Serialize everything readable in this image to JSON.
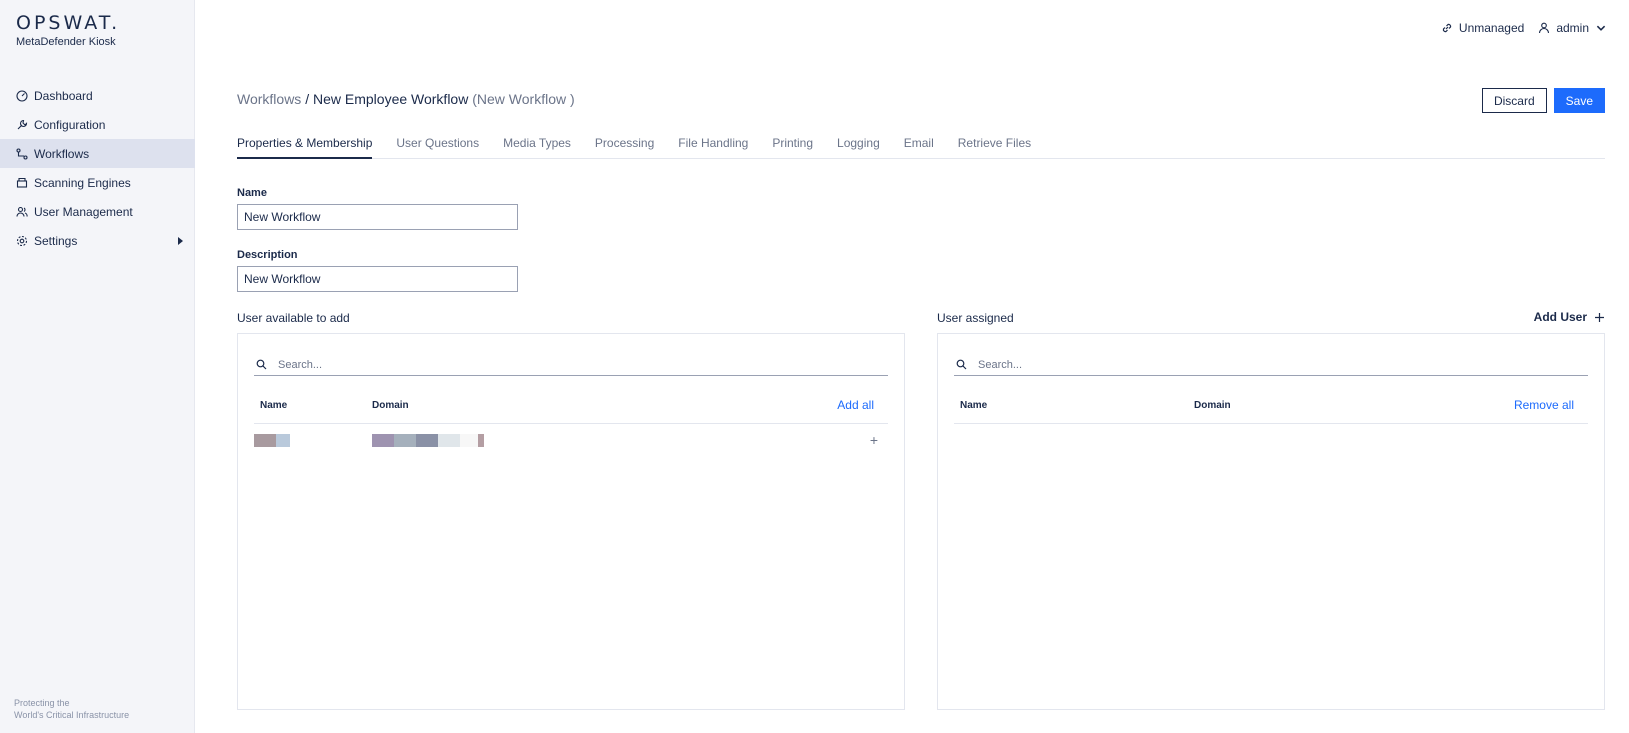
{
  "brand": {
    "logo": "OPSWAT.",
    "product": "MetaDefender Kiosk"
  },
  "nav": [
    {
      "label": "Dashboard",
      "icon": "gauge-icon"
    },
    {
      "label": "Configuration",
      "icon": "wrench-icon"
    },
    {
      "label": "Workflows",
      "icon": "workflow-icon",
      "active": true
    },
    {
      "label": "Scanning Engines",
      "icon": "engine-icon"
    },
    {
      "label": "User Management",
      "icon": "users-icon"
    },
    {
      "label": "Settings",
      "icon": "gear-icon"
    }
  ],
  "sidebar_footer": {
    "line1": "Protecting the",
    "line2": "World's Critical Infrastructure"
  },
  "topbar": {
    "status": "Unmanaged",
    "user": "admin"
  },
  "breadcrumb": {
    "root": "Workflows",
    "separator": "/",
    "current": "New Employee Workflow",
    "suffix": "(New Workflow )"
  },
  "actions": {
    "discard": "Discard",
    "save": "Save"
  },
  "tabs": [
    "Properties & Membership",
    "User Questions",
    "Media Types",
    "Processing",
    "File Handling",
    "Printing",
    "Logging",
    "Email",
    "Retrieve Files"
  ],
  "form": {
    "name_label": "Name",
    "name_value": "New Workflow",
    "description_label": "Description",
    "description_value": "New Workflow"
  },
  "available": {
    "title": "User available to add",
    "search_placeholder": "Search...",
    "col_name": "Name",
    "col_domain": "Domain",
    "action": "Add all",
    "row_add": "+"
  },
  "assigned": {
    "title": "User assigned",
    "add_user": "Add User",
    "search_placeholder": "Search...",
    "col_name": "Name",
    "col_domain": "Domain",
    "action": "Remove all"
  },
  "colors": {
    "accent": "#1d6bfc",
    "text": "#1b2a4a",
    "sidebar": "#f4f5f9"
  }
}
